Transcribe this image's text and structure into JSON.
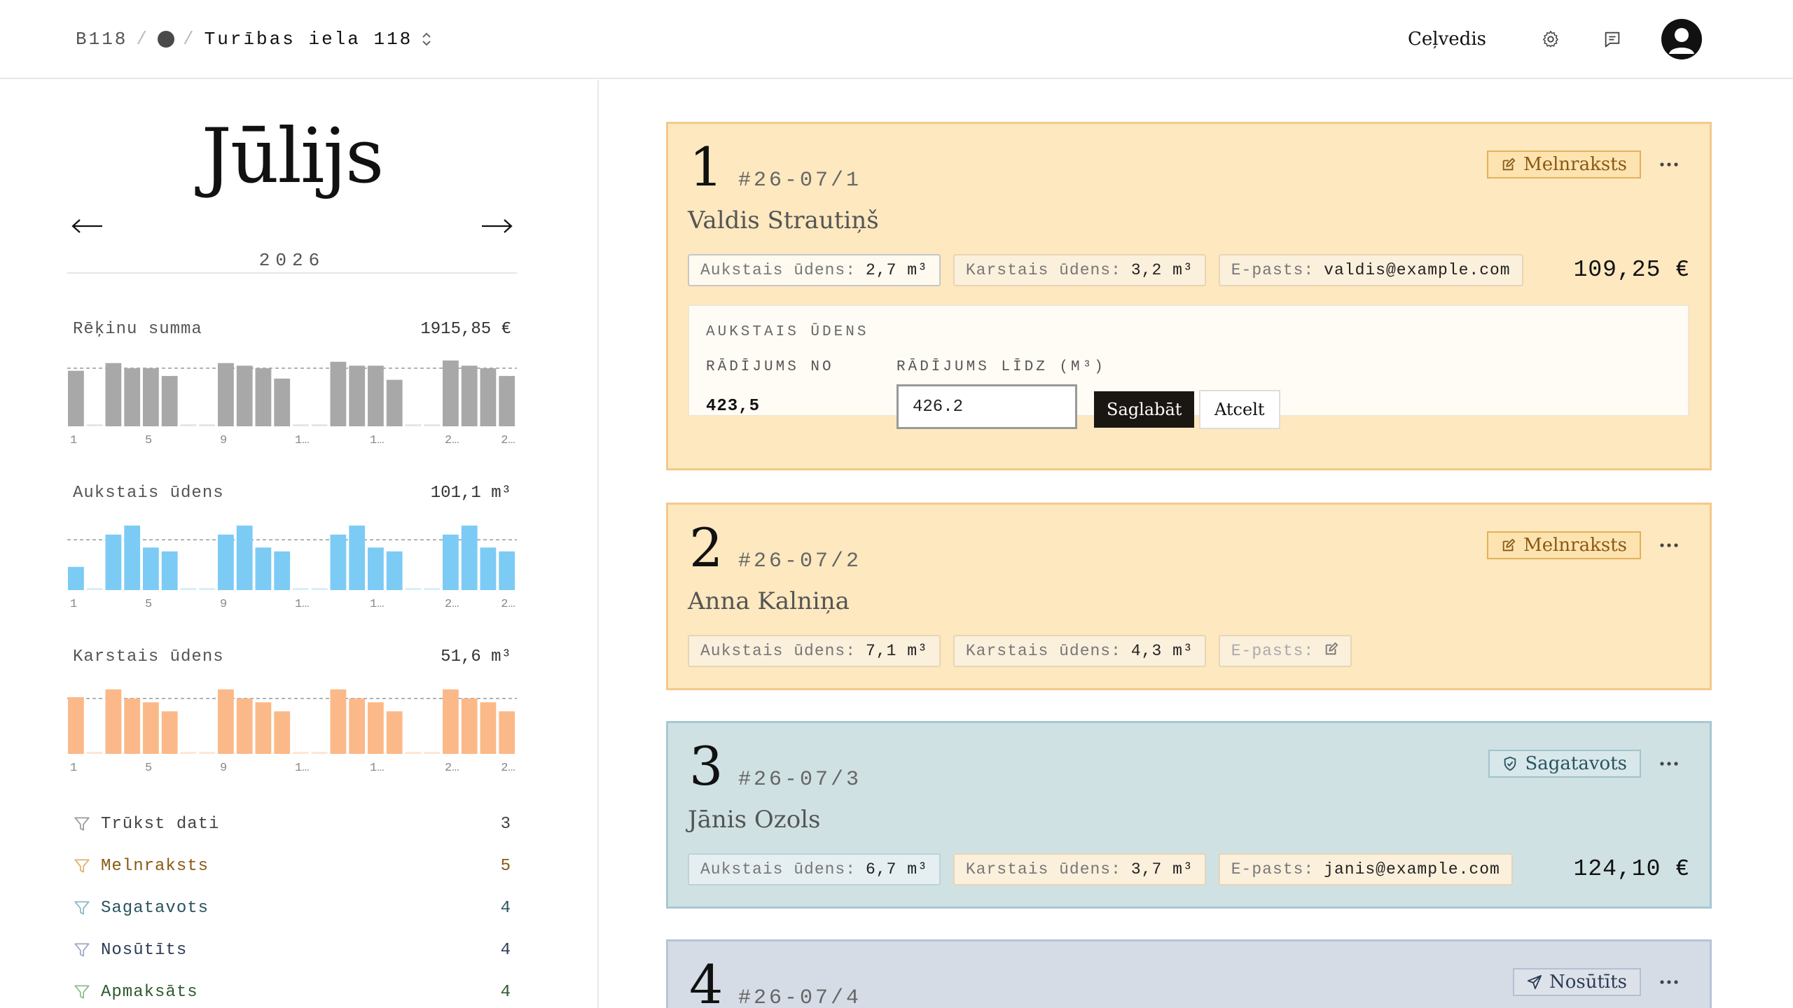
{
  "breadcrumb": {
    "code": "B118",
    "address": "Turības iela 118"
  },
  "topnav": {
    "guide": "Ceļvedis"
  },
  "calendar": {
    "month": "Jūlijs",
    "year": "2026"
  },
  "metrics": [
    {
      "label": "Rēķinu summa",
      "total": "1915,85 €",
      "color": "#a8a8a8",
      "bar_color_zero": "#e6e6e6"
    },
    {
      "label": "Aukstais ūdens",
      "total": "101,1 m³",
      "color": "#7ccbf4",
      "bar_color_zero": "#d8eef9"
    },
    {
      "label": "Karstais ūdens",
      "total": "51,6 m³",
      "color": "#fbb989",
      "bar_color_zero": "#fde6d5"
    }
  ],
  "chart_data": [
    {
      "type": "bar",
      "title": "Rēķinu summa",
      "categories": [
        "1",
        "2",
        "3",
        "4",
        "5",
        "6",
        "7",
        "8",
        "9",
        "10",
        "11",
        "12",
        "13",
        "14",
        "15",
        "16",
        "17",
        "18",
        "19",
        "20",
        "21",
        "22",
        "23",
        "24"
      ],
      "tick_labels": [
        "1",
        "5",
        "9",
        "1…",
        "1…",
        "2…",
        "2…"
      ],
      "values": [
        0.86,
        0,
        0.98,
        0.9,
        0.9,
        0.78,
        0,
        0,
        0.98,
        0.94,
        0.9,
        0.74,
        0,
        0,
        1.0,
        0.94,
        0.94,
        0.72,
        0,
        0,
        1.02,
        0.94,
        0.9,
        0.78
      ],
      "reference_line": 0.9,
      "grid": false
    },
    {
      "type": "bar",
      "title": "Aukstais ūdens",
      "categories": [
        "1",
        "2",
        "3",
        "4",
        "5",
        "6",
        "7",
        "8",
        "9",
        "10",
        "11",
        "12",
        "13",
        "14",
        "15",
        "16",
        "17",
        "18",
        "19",
        "20",
        "21",
        "22",
        "23",
        "24"
      ],
      "tick_labels": [
        "1",
        "5",
        "9",
        "1…",
        "1…",
        "2…",
        "2…"
      ],
      "values": [
        0.36,
        0,
        0.86,
        1.0,
        0.66,
        0.6,
        0,
        0,
        0.86,
        1.0,
        0.66,
        0.6,
        0,
        0,
        0.86,
        1.0,
        0.66,
        0.6,
        0,
        0,
        0.86,
        1.0,
        0.66,
        0.6
      ],
      "reference_line": 0.78,
      "grid": false
    },
    {
      "type": "bar",
      "title": "Karstais ūdens",
      "categories": [
        "1",
        "2",
        "3",
        "4",
        "5",
        "6",
        "7",
        "8",
        "9",
        "10",
        "11",
        "12",
        "13",
        "14",
        "15",
        "16",
        "17",
        "18",
        "19",
        "20",
        "21",
        "22",
        "23",
        "24"
      ],
      "tick_labels": [
        "1",
        "5",
        "9",
        "1…",
        "1…",
        "2…",
        "2…"
      ],
      "values": [
        0.88,
        0,
        1.0,
        0.86,
        0.8,
        0.66,
        0,
        0,
        1.0,
        0.86,
        0.8,
        0.66,
        0,
        0,
        1.0,
        0.86,
        0.8,
        0.66,
        0,
        0,
        1.0,
        0.86,
        0.8,
        0.66
      ],
      "reference_line": 0.86,
      "grid": false
    }
  ],
  "filters": [
    {
      "label": "Trūkst dati",
      "count": "3",
      "color": "#444444",
      "icon_color": "#999999"
    },
    {
      "label": "Melnraksts",
      "count": "5",
      "color": "#8a5a14",
      "icon_color": "#e0b06a"
    },
    {
      "label": "Sagatavots",
      "count": "4",
      "color": "#2a5360",
      "icon_color": "#8bb6c4"
    },
    {
      "label": "Nosūtīts",
      "count": "4",
      "color": "#2d3c55",
      "icon_color": "#99a8c0"
    },
    {
      "label": "Apmaksāts",
      "count": "4",
      "color": "#2e5a2e",
      "icon_color": "#8dbb8d"
    }
  ],
  "cards": [
    {
      "num": "1",
      "id": "#26-07/1",
      "name": "Valdis Strautiņš",
      "status": "Melnraksts",
      "chips": [
        {
          "key": "Aukstais ūdens:",
          "value": "2,7 m³"
        },
        {
          "key": "Karstais ūdens:",
          "value": "3,2 m³"
        },
        {
          "key": "E-pasts:",
          "value": "valdis@example.com"
        }
      ],
      "total": "109,25 €",
      "editor": {
        "title": "AUKSTAIS ŪDENS",
        "from_label": "RĀDĪJUMS NO",
        "to_label": "RĀDĪJUMS LĪDZ (M³)",
        "from_value": "423,5",
        "to_value": "426.2",
        "save": "Saglabāt",
        "cancel": "Atcelt"
      }
    },
    {
      "num": "2",
      "id": "#26-07/2",
      "name": "Anna Kalniņa",
      "status": "Melnraksts",
      "chips": [
        {
          "key": "Aukstais ūdens:",
          "value": "7,1 m³"
        },
        {
          "key": "Karstais ūdens:",
          "value": "4,3 m³"
        },
        {
          "key": "E-pasts:",
          "value": ""
        }
      ]
    },
    {
      "num": "3",
      "id": "#26-07/3",
      "name": "Jānis Ozols",
      "status": "Sagatavots",
      "chips": [
        {
          "key": "Aukstais ūdens:",
          "value": "6,7 m³"
        },
        {
          "key": "Karstais ūdens:",
          "value": "3,7 m³"
        },
        {
          "key": "E-pasts:",
          "value": "janis@example.com"
        }
      ],
      "total": "124,10 €"
    },
    {
      "num": "4",
      "id": "#26-07/4",
      "status": "Nosūtīts"
    }
  ],
  "icons": {
    "chevron": "chevron-up-down-icon",
    "settings": "gear-icon",
    "messages": "message-icon",
    "avatar": "user-avatar-icon",
    "prev": "arrow-left-icon",
    "next": "arrow-right-icon",
    "filter": "filter-funnel-icon",
    "draft": "edit-icon",
    "prepared": "shield-check-icon",
    "sent": "send-icon",
    "more": "more-horizontal-icon"
  }
}
